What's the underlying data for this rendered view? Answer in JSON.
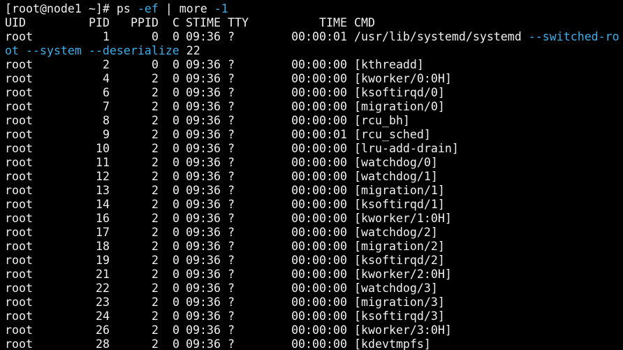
{
  "terminal": {
    "prompt": "[root@node1 ~]# ",
    "command_name": "ps",
    "command_flag": "-ef",
    "pipe": " | more ",
    "more_flag": "-1",
    "option_color": "#3daee9",
    "text_color": "#f0f0f0",
    "background": "#000000"
  },
  "header": {
    "uid": "UID",
    "pid": "PID",
    "ppid": "PPID",
    "c": "C",
    "stime": "STIME",
    "tty": "TTY",
    "time": "TIME",
    "cmd": "CMD"
  },
  "systemd": {
    "uid": "root",
    "pid": "1",
    "ppid": "0",
    "c": "0",
    "stime": "09:36",
    "tty": "?",
    "time": "00:00:01",
    "cmd_path": "/usr/lib/systemd/systemd ",
    "cmd_flag1": "--switched-ro",
    "wrap_flag1_end": "ot",
    "wrap_space": " ",
    "wrap_flag2": "--system",
    "wrap_flag3": "--deserialize",
    "wrap_value": " 22"
  },
  "processes": [
    {
      "uid": "root",
      "pid": "2",
      "ppid": "0",
      "c": "0",
      "stime": "09:36",
      "tty": "?",
      "time": "00:00:00",
      "cmd": "[kthreadd]"
    },
    {
      "uid": "root",
      "pid": "4",
      "ppid": "2",
      "c": "0",
      "stime": "09:36",
      "tty": "?",
      "time": "00:00:00",
      "cmd": "[kworker/0:0H]"
    },
    {
      "uid": "root",
      "pid": "6",
      "ppid": "2",
      "c": "0",
      "stime": "09:36",
      "tty": "?",
      "time": "00:00:00",
      "cmd": "[ksoftirqd/0]"
    },
    {
      "uid": "root",
      "pid": "7",
      "ppid": "2",
      "c": "0",
      "stime": "09:36",
      "tty": "?",
      "time": "00:00:00",
      "cmd": "[migration/0]"
    },
    {
      "uid": "root",
      "pid": "8",
      "ppid": "2",
      "c": "0",
      "stime": "09:36",
      "tty": "?",
      "time": "00:00:00",
      "cmd": "[rcu_bh]"
    },
    {
      "uid": "root",
      "pid": "9",
      "ppid": "2",
      "c": "0",
      "stime": "09:36",
      "tty": "?",
      "time": "00:00:01",
      "cmd": "[rcu_sched]"
    },
    {
      "uid": "root",
      "pid": "10",
      "ppid": "2",
      "c": "0",
      "stime": "09:36",
      "tty": "?",
      "time": "00:00:00",
      "cmd": "[lru-add-drain]"
    },
    {
      "uid": "root",
      "pid": "11",
      "ppid": "2",
      "c": "0",
      "stime": "09:36",
      "tty": "?",
      "time": "00:00:00",
      "cmd": "[watchdog/0]"
    },
    {
      "uid": "root",
      "pid": "12",
      "ppid": "2",
      "c": "0",
      "stime": "09:36",
      "tty": "?",
      "time": "00:00:00",
      "cmd": "[watchdog/1]"
    },
    {
      "uid": "root",
      "pid": "13",
      "ppid": "2",
      "c": "0",
      "stime": "09:36",
      "tty": "?",
      "time": "00:00:00",
      "cmd": "[migration/1]"
    },
    {
      "uid": "root",
      "pid": "14",
      "ppid": "2",
      "c": "0",
      "stime": "09:36",
      "tty": "?",
      "time": "00:00:00",
      "cmd": "[ksoftirqd/1]"
    },
    {
      "uid": "root",
      "pid": "16",
      "ppid": "2",
      "c": "0",
      "stime": "09:36",
      "tty": "?",
      "time": "00:00:00",
      "cmd": "[kworker/1:0H]"
    },
    {
      "uid": "root",
      "pid": "17",
      "ppid": "2",
      "c": "0",
      "stime": "09:36",
      "tty": "?",
      "time": "00:00:00",
      "cmd": "[watchdog/2]"
    },
    {
      "uid": "root",
      "pid": "18",
      "ppid": "2",
      "c": "0",
      "stime": "09:36",
      "tty": "?",
      "time": "00:00:00",
      "cmd": "[migration/2]"
    },
    {
      "uid": "root",
      "pid": "19",
      "ppid": "2",
      "c": "0",
      "stime": "09:36",
      "tty": "?",
      "time": "00:00:00",
      "cmd": "[ksoftirqd/2]"
    },
    {
      "uid": "root",
      "pid": "21",
      "ppid": "2",
      "c": "0",
      "stime": "09:36",
      "tty": "?",
      "time": "00:00:00",
      "cmd": "[kworker/2:0H]"
    },
    {
      "uid": "root",
      "pid": "22",
      "ppid": "2",
      "c": "0",
      "stime": "09:36",
      "tty": "?",
      "time": "00:00:00",
      "cmd": "[watchdog/3]"
    },
    {
      "uid": "root",
      "pid": "23",
      "ppid": "2",
      "c": "0",
      "stime": "09:36",
      "tty": "?",
      "time": "00:00:00",
      "cmd": "[migration/3]"
    },
    {
      "uid": "root",
      "pid": "24",
      "ppid": "2",
      "c": "0",
      "stime": "09:36",
      "tty": "?",
      "time": "00:00:00",
      "cmd": "[ksoftirqd/3]"
    },
    {
      "uid": "root",
      "pid": "26",
      "ppid": "2",
      "c": "0",
      "stime": "09:36",
      "tty": "?",
      "time": "00:00:00",
      "cmd": "[kworker/3:0H]"
    },
    {
      "uid": "root",
      "pid": "28",
      "ppid": "2",
      "c": "0",
      "stime": "09:36",
      "tty": "?",
      "time": "00:00:00",
      "cmd": "[kdevtmpfs]"
    }
  ]
}
